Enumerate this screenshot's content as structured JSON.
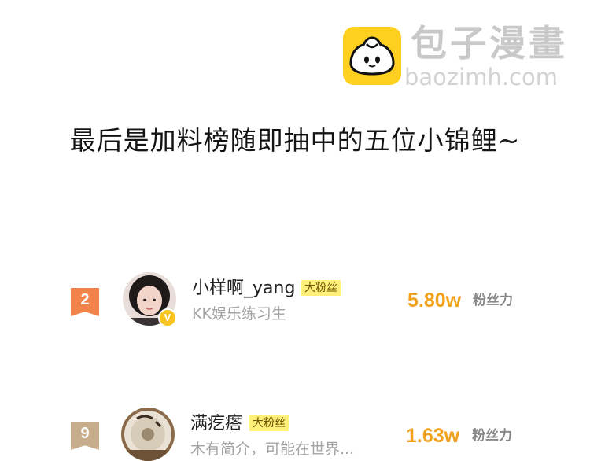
{
  "watermark": {
    "brand_cn": "包子漫畫",
    "brand_url": "baozimh.com"
  },
  "headline": "最后是加料榜随即抽中的五位小锦鲤~",
  "colors": {
    "logo": "#ffcf1f",
    "score": "#f2a21d",
    "rank_2": "#f2844b",
    "rank_9": "#c7ad8b",
    "fan_tag_bg": "#fff07a",
    "verified": "#f7c51e"
  },
  "ranking": [
    {
      "rank": "2",
      "username": "小样啊_yang",
      "tag": "大粉丝",
      "subtitle": "KK娱乐练习生",
      "score": "5.80w",
      "score_label": "粉丝力",
      "verified_icon": "v-badge-icon"
    },
    {
      "rank": "9",
      "username": "满疙瘩",
      "tag": "大粉丝",
      "subtitle": "木有简介，可能在世界...",
      "score": "1.63w",
      "score_label": "粉丝力"
    }
  ]
}
